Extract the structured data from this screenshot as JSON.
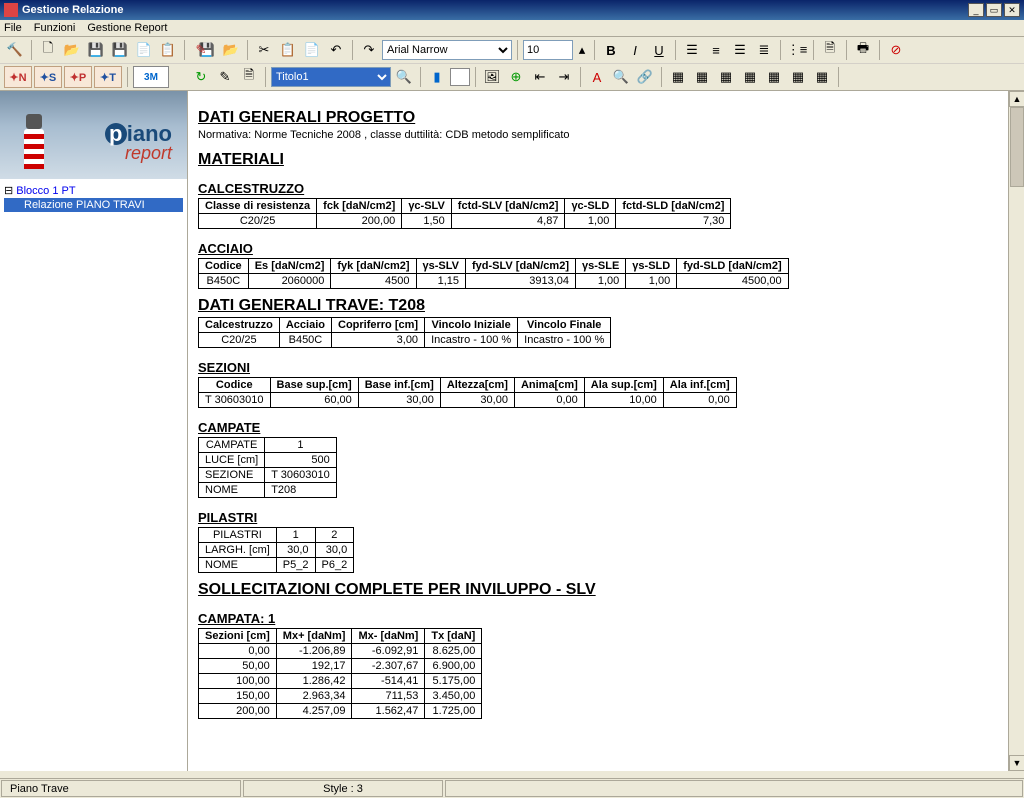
{
  "window": {
    "title": "Gestione Relazione"
  },
  "menu": {
    "file": "File",
    "funzioni": "Funzioni",
    "gestione_report": "Gestione Report"
  },
  "toolbar": {
    "font_name": "Arial Narrow",
    "font_size": "10",
    "style_select": "Titolo1"
  },
  "sidebar": {
    "root": "Blocco 1 PT",
    "child": "Relazione PIANO TRAVI"
  },
  "logo": {
    "brand": "iano",
    "p": "p",
    "sub": "report"
  },
  "doc": {
    "h_dati_generali": "DATI GENERALI PROGETTO",
    "normativa": "Normativa: Norme Tecniche 2008 , classe duttilità: CDB metodo semplificato",
    "h_materiali": "MATERIALI",
    "h_calc": "CALCESTRUZZO",
    "calc_headers": [
      "Classe di resistenza",
      "fck [daN/cm2]",
      "γc-SLV",
      "fctd-SLV [daN/cm2]",
      "γc-SLD",
      "fctd-SLD [daN/cm2]"
    ],
    "calc_row": [
      "C20/25",
      "200,00",
      "1,50",
      "4,87",
      "1,00",
      "7,30"
    ],
    "h_acc": "ACCIAIO",
    "acc_headers": [
      "Codice",
      "Es [daN/cm2]",
      "fyk [daN/cm2]",
      "γs-SLV",
      "fyd-SLV [daN/cm2]",
      "γs-SLE",
      "γs-SLD",
      "fyd-SLD [daN/cm2]"
    ],
    "acc_row": [
      "B450C",
      "2060000",
      "4500",
      "1,15",
      "3913,04",
      "1,00",
      "1,00",
      "4500,00"
    ],
    "h_trave": "DATI GENERALI TRAVE: T208",
    "trave_headers": [
      "Calcestruzzo",
      "Acciaio",
      "Copriferro [cm]",
      "Vincolo Iniziale",
      "Vincolo Finale"
    ],
    "trave_row": [
      "C20/25",
      "B450C",
      "3,00",
      "Incastro - 100 %",
      "Incastro - 100 %"
    ],
    "h_sez": "SEZIONI",
    "sez_headers": [
      "Codice",
      "Base sup.[cm]",
      "Base inf.[cm]",
      "Altezza[cm]",
      "Anima[cm]",
      "Ala sup.[cm]",
      "Ala inf.[cm]"
    ],
    "sez_row": [
      "T 30603010",
      "60,00",
      "30,00",
      "30,00",
      "0,00",
      "10,00",
      "0,00"
    ],
    "h_camp": "CAMPATE",
    "camp_rows": [
      [
        "CAMPATE",
        "1"
      ],
      [
        "LUCE [cm]",
        "500"
      ],
      [
        "SEZIONE",
        "T 30603010"
      ],
      [
        "NOME",
        "T208"
      ]
    ],
    "h_pil": "PILASTRI",
    "pil_h": [
      "PILASTRI",
      "1",
      "2"
    ],
    "pil_rows": [
      [
        "LARGH. [cm]",
        "30,0",
        "30,0"
      ],
      [
        "NOME",
        "P5_2",
        "P6_2"
      ]
    ],
    "h_soll": "SOLLECITAZIONI COMPLETE PER INVILUPPO - SLV",
    "h_camp1": "CAMPATA: 1",
    "soll_headers": [
      "Sezioni [cm]",
      "Mx+ [daNm]",
      "Mx- [daNm]",
      "Tx [daN]"
    ],
    "soll_rows": [
      [
        "0,00",
        "-1.206,89",
        "-6.092,91",
        "8.625,00"
      ],
      [
        "50,00",
        "192,17",
        "-2.307,67",
        "6.900,00"
      ],
      [
        "100,00",
        "1.286,42",
        "-514,41",
        "5.175,00"
      ],
      [
        "150,00",
        "2.963,34",
        "711,53",
        "3.450,00"
      ],
      [
        "200,00",
        "4.257,09",
        "1.562,47",
        "1.725,00"
      ]
    ]
  },
  "status": {
    "left": "Piano Trave",
    "mid": "Style : 3"
  }
}
